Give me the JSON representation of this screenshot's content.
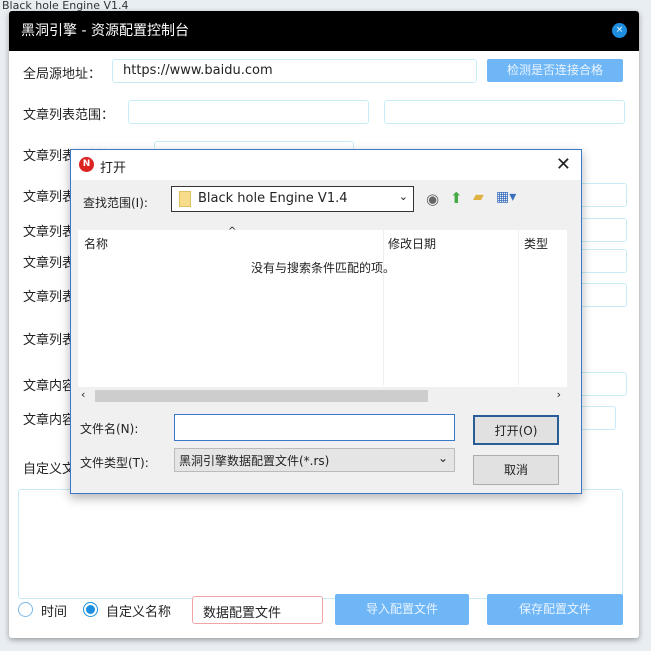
{
  "background_title": "Black hole Engine V1.4",
  "window": {
    "title": "黑洞引擎 - 资源配置控制台",
    "close_label": "×",
    "source_label": "全局源地址：",
    "source_value": "https://www.baidu.com",
    "check_button": "检测是否连接合格",
    "labels": [
      "文章列表范围：",
      "文章列表分割标记",
      "文章列表",
      "文章列表",
      "文章列表",
      "文章列表",
      "文章列表",
      "文章内容",
      "文章内容",
      "自定义文"
    ],
    "radio_time": "时间",
    "radio_custom": "自定义名称",
    "filename_value": "数据配置文件",
    "import_button": "导入配置文件",
    "save_button": "保存配置文件",
    "accent": "#6fb6f7"
  },
  "dialog": {
    "title": "打开",
    "lookin_label": "查找范围(I):",
    "lookin_value": "Black hole Engine V1.4",
    "columns": [
      "名称",
      "修改日期",
      "类型"
    ],
    "empty_message": "没有与搜索条件匹配的项。",
    "filename_label": "文件名(N):",
    "filename_value": "",
    "filetype_label": "文件类型(T):",
    "filetype_value": "黑洞引擎数据配置文件(*.rs)",
    "open_button": "打开(O)",
    "cancel_button": "取消"
  }
}
